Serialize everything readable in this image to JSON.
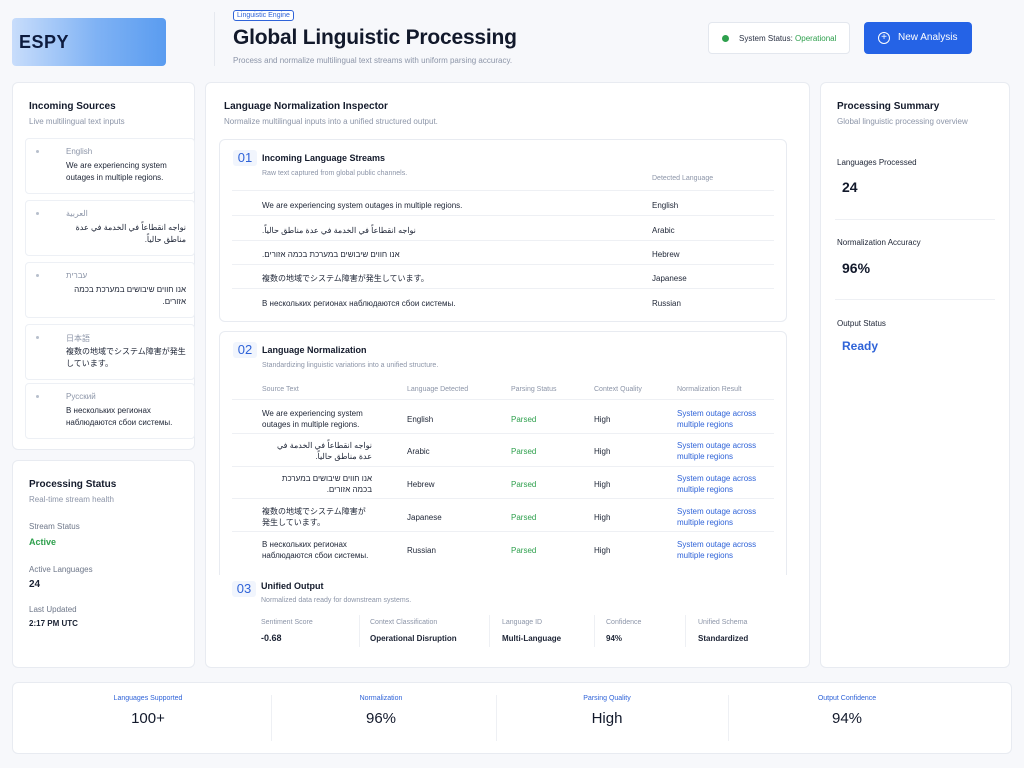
{
  "header": {
    "logo": "ESPY",
    "tag": "Linguistic Engine",
    "title": "Global Linguistic Processing",
    "subtitle": "Process and normalize multilingual text streams with uniform parsing accuracy.",
    "status_label": "System Status:",
    "status_value": "Operational",
    "new_analysis": "New Analysis"
  },
  "sources": {
    "title": "Incoming Sources",
    "subtitle": "Live multilingual text inputs",
    "items": [
      {
        "lang": "English",
        "text": "We are experiencing system outages in multiple regions."
      },
      {
        "lang": "العربية",
        "text": "نواجه انقطاعاً في الخدمة في عدة مناطق حالياً."
      },
      {
        "lang": "עברית",
        "text": "אנו חווים שיבושים במערכת בכמה אזורים."
      },
      {
        "lang": "日本語",
        "text": "複数の地域でシステム障害が発生しています。"
      },
      {
        "lang": "Русский",
        "text": "В нескольких регионах наблюдаются сбои системы."
      }
    ]
  },
  "processing": {
    "title": "Processing Status",
    "subtitle": "Real-time stream health",
    "stream_label": "Stream Status",
    "stream_value": "Active",
    "active_label": "Active Languages",
    "active_value": "24",
    "updated_label": "Last Updated",
    "updated_value": "2:17 PM UTC"
  },
  "inspector": {
    "title": "Language Normalization Inspector",
    "subtitle": "Normalize multilingual inputs into a unified structured output.",
    "s1": {
      "num": "01",
      "title": "Incoming Language Streams",
      "subtitle": "Raw text captured from global public channels.",
      "col_detected": "Detected Language",
      "rows": [
        {
          "text": "We are experiencing system outages in multiple regions.",
          "lang": "English"
        },
        {
          "text": "نواجه انقطاعاً في الخدمة في عدة مناطق حالياً.",
          "lang": "Arabic"
        },
        {
          "text": "אנו חווים שיבושים במערכת בכמה אזורים.",
          "lang": "Hebrew"
        },
        {
          "text": "複数の地域でシステム障害が発生しています。",
          "lang": "Japanese"
        },
        {
          "text": "В нескольких регионах наблюдаются сбои системы.",
          "lang": "Russian"
        }
      ]
    },
    "s2": {
      "num": "02",
      "title": "Language Normalization",
      "subtitle": "Standardizing linguistic variations into a unified structure.",
      "headers": [
        "Source Text",
        "Language Detected",
        "Parsing Status",
        "Context Quality",
        "Normalization Result"
      ],
      "rows": [
        {
          "src": "We are experiencing system outages in multiple regions.",
          "lang": "English",
          "status": "Parsed",
          "quality": "High",
          "result": "System outage across multiple regions"
        },
        {
          "src": "نواجه انقطاعاً في الخدمة في عدة مناطق حالياً.",
          "lang": "Arabic",
          "status": "Parsed",
          "quality": "High",
          "result": "System outage across multiple regions"
        },
        {
          "src": "אנו חווים שיבושים במערכת בכמה אזורים.",
          "lang": "Hebrew",
          "status": "Parsed",
          "quality": "High",
          "result": "System outage across multiple regions"
        },
        {
          "src": "複数の地域でシステム障害が発生しています。",
          "lang": "Japanese",
          "status": "Parsed",
          "quality": "High",
          "result": "System outage across multiple regions"
        },
        {
          "src": "В нескольких регионах наблюдаются сбои системы.",
          "lang": "Russian",
          "status": "Parsed",
          "quality": "High",
          "result": "System outage across multiple regions"
        }
      ]
    },
    "s3": {
      "num": "03",
      "title": "Unified Output",
      "subtitle": "Normalized data ready for downstream systems.",
      "fields": [
        {
          "label": "Sentiment Score",
          "value": "-0.68"
        },
        {
          "label": "Context Classification",
          "value": "Operational Disruption"
        },
        {
          "label": "Language ID",
          "value": "Multi-Language"
        },
        {
          "label": "Confidence",
          "value": "94%"
        },
        {
          "label": "Unified Schema",
          "value": "Standardized"
        }
      ]
    }
  },
  "summary": {
    "title": "Processing Summary",
    "subtitle": "Global linguistic processing overview",
    "languages_label": "Languages Processed",
    "languages_value": "24",
    "accuracy_label": "Normalization Accuracy",
    "accuracy_value": "96%",
    "output_label": "Output Status",
    "output_value": "Ready"
  },
  "footer": [
    {
      "label": "Languages Supported",
      "value": "100+"
    },
    {
      "label": "Normalization",
      "value": "96%"
    },
    {
      "label": "Parsing Quality",
      "value": "High"
    },
    {
      "label": "Output Confidence",
      "value": "94%"
    }
  ]
}
